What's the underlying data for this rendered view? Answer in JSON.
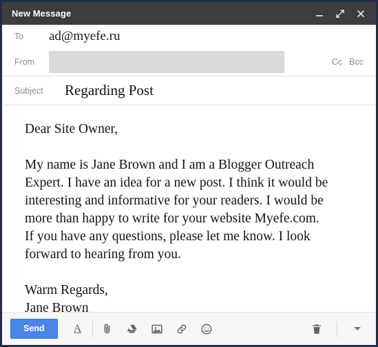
{
  "window": {
    "title": "New Message",
    "controls": [
      {
        "name": "minimize",
        "glyph": "minimize-icon"
      },
      {
        "name": "expand",
        "glyph": "expand-icon"
      },
      {
        "name": "close",
        "glyph": "close-icon"
      }
    ],
    "border_color": "#1f2d4a",
    "titlebar_color": "#3d3d3d"
  },
  "compose": {
    "to": {
      "label": "To",
      "value": "ad@myefe.ru",
      "placeholder": "Recipients"
    },
    "from": {
      "label": "From",
      "value": "",
      "placeholder": "",
      "redacted": true,
      "redaction_color": "#dadada"
    },
    "cc_label": "Cc",
    "bcc_label": "Bcc",
    "subject": {
      "label": "Subject",
      "value": "Regarding Post",
      "placeholder": "Subject"
    },
    "body": {
      "text": "Dear Site Owner,\n\nMy name is Jane Brown and I am a Blogger Outreach\nExpert. I have an idea for a new post. I think it would be\ninteresting and informative for your readers. I would be\nmore than happy to write for your website Myefe.com.\nIf you have any questions, please let me know. I look\nforward to hearing from you.\n\nWarm Regards,\nJane Brown",
      "placeholder": "Compose email"
    }
  },
  "toolbar": {
    "send_label": "Send",
    "send_color": "#4a86e8",
    "tools": [
      {
        "name": "formatting-options",
        "icon": "format-text-icon",
        "glyph": "A"
      },
      {
        "name": "attach-file",
        "icon": "paperclip-icon"
      },
      {
        "name": "insert-drive",
        "icon": "google-drive-icon"
      },
      {
        "name": "insert-photo",
        "icon": "image-icon"
      },
      {
        "name": "insert-link",
        "icon": "link-icon"
      },
      {
        "name": "insert-emoji",
        "icon": "emoji-icon"
      }
    ],
    "discard": {
      "name": "discard-draft",
      "icon": "trash-icon"
    },
    "more": {
      "name": "more-options",
      "icon": "caret-down-icon"
    }
  }
}
